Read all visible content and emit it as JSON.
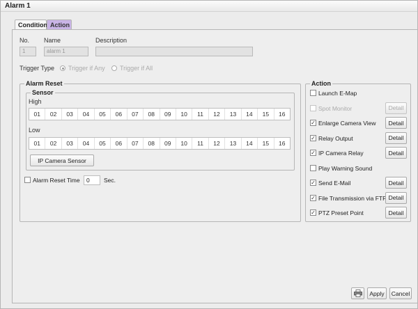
{
  "window": {
    "title": "Alarm 1"
  },
  "tabs": [
    {
      "label": "Condition"
    },
    {
      "label": "Action"
    }
  ],
  "header": {
    "no_label": "No.",
    "no_value": "1",
    "name_label": "Name",
    "name_value": "alarm 1",
    "description_label": "Description",
    "description_value": ""
  },
  "trigger": {
    "label": "Trigger Type",
    "option_any": "Trigger if Any",
    "option_all": "Trigger if All"
  },
  "alarm_reset": {
    "title": "Alarm Reset",
    "sensor_title": "Sensor",
    "high_label": "High",
    "low_label": "Low",
    "high": [
      "01",
      "02",
      "03",
      "04",
      "05",
      "06",
      "07",
      "08",
      "09",
      "10",
      "11",
      "12",
      "13",
      "14",
      "15",
      "16"
    ],
    "low": [
      "01",
      "02",
      "03",
      "04",
      "05",
      "06",
      "07",
      "08",
      "09",
      "10",
      "11",
      "12",
      "13",
      "14",
      "15",
      "16"
    ],
    "ip_camera_sensor_button": "IP Camera Sensor",
    "reset_time_label": "Alarm Reset Time",
    "reset_time_value": "0",
    "reset_time_unit": "Sec."
  },
  "action": {
    "title": "Action",
    "detail_label": "Detail",
    "items": [
      {
        "label": "Launch E-Map",
        "checked": false,
        "disabled": false,
        "detail": false
      },
      {
        "label": "Spot Monitor",
        "checked": false,
        "disabled": true,
        "detail": true
      },
      {
        "label": "Enlarge Camera View",
        "checked": true,
        "disabled": false,
        "detail": true
      },
      {
        "label": "Relay Output",
        "checked": true,
        "disabled": false,
        "detail": true
      },
      {
        "label": "IP Camera Relay",
        "checked": true,
        "disabled": false,
        "detail": true
      },
      {
        "label": "Play Warning Sound",
        "checked": false,
        "disabled": false,
        "detail": false
      },
      {
        "label": "Send E-Mail",
        "checked": true,
        "disabled": false,
        "detail": true
      },
      {
        "label": "File Transmission via FTP",
        "checked": true,
        "disabled": false,
        "detail": true
      },
      {
        "label": "PTZ Preset Point",
        "checked": true,
        "disabled": false,
        "detail": true
      }
    ]
  },
  "footer": {
    "apply": "Apply",
    "cancel": "Cancel",
    "print_icon": "printer-icon"
  }
}
